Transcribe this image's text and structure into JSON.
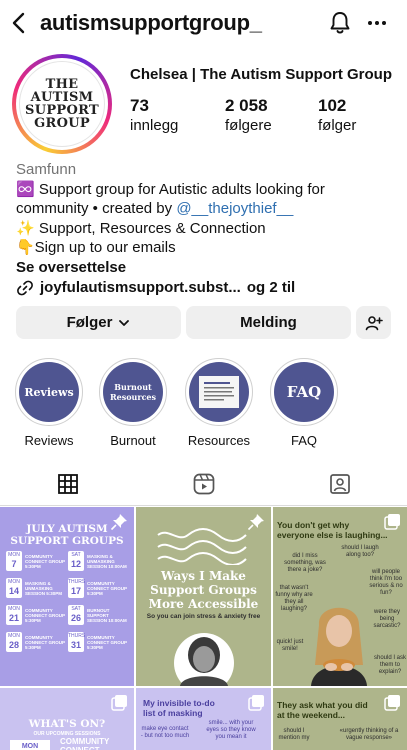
{
  "header": {
    "username": "autismsupportgroup_"
  },
  "profile": {
    "avatar_text": "THE\nAUTISM\nSUPPORT\nGROUP",
    "display_name": "Chelsea | The Autism Support Group",
    "stats": [
      {
        "value": "73",
        "label": "innlegg"
      },
      {
        "value": "2 058",
        "label": "følgere"
      },
      {
        "value": "102",
        "label": "følger"
      }
    ]
  },
  "bio": {
    "category": "Samfunn",
    "line1": "♾️ Support group for Autistic adults looking for",
    "line2_prefix": "community • created by ",
    "mention": "@__thejoythief__",
    "line3": "✨ Support, Resources & Connection",
    "line4": "👇Sign up to our emails",
    "translate": "Se oversettelse",
    "link": "joyfulautismsupport.subst...",
    "link_extra": "og 2 til"
  },
  "actions": {
    "following_label": "Følger",
    "message_label": "Melding"
  },
  "highlights": [
    {
      "label": "Reviews",
      "cover": "Reviews"
    },
    {
      "label": "Burnout",
      "cover": "Burnout\nResources"
    },
    {
      "label": "Resources",
      "cover": ""
    },
    {
      "label": "FAQ",
      "cover": "FAQ"
    }
  ],
  "posts": {
    "p1": {
      "title": "JULY AUTISM\nSUPPORT GROUPS",
      "rows": [
        {
          "d1": "MON",
          "n1": "7",
          "t1": "Community Connect Group 5:30pm",
          "d2": "SAT",
          "n2": "12",
          "t2": "Masking & Unmasking Session 10:00am"
        },
        {
          "d1": "MON",
          "n1": "14",
          "t1": "Masking & Unmasking Session 5:30pm",
          "d2": "THURS",
          "n2": "17",
          "t2": "Community Connect Group 5:30pm"
        },
        {
          "d1": "MON",
          "n1": "21",
          "t1": "Community Connect Group 5:30pm",
          "d2": "SAT",
          "n2": "26",
          "t2": "Burnout Support Session 10:00am"
        },
        {
          "d1": "MON",
          "n1": "28",
          "t1": "Community Connect Group 5:30pm",
          "d2": "THURS",
          "n2": "31",
          "t2": "Community Connect Group 5:30pm"
        }
      ]
    },
    "p2": {
      "title": "Ways I Make\nSupport Groups\nMore Accessible",
      "subtitle": "So you can join stress & anxiety free"
    },
    "p3": {
      "title": "You don't get why\neveryone else is laughing...",
      "bubbles": [
        "did I miss something, was there a joke?",
        "should I laugh along too?",
        "will people think I'm too serious & no fun?",
        "that wasn't funny why are they all laughing?",
        "were they being sarcastic?",
        "quick! just smile!",
        "should I ask them to explain?"
      ]
    },
    "p4": {
      "title": "WHAT'S ON?",
      "subtitle": "OUR UPCOMING SESSIONS",
      "day": "MON",
      "session": "COMMUNITY\nCONNECT"
    },
    "p5": {
      "title": "My invisible to-do\nlist of masking",
      "bubbles": [
        "make eye contact - but not too much",
        "smile... with your eyes so they know you mean it"
      ]
    },
    "p6": {
      "title": "They ask what you did\nat the weekend...",
      "bubbles": [
        "should I mention my",
        "«urgently thinking of a vague response»"
      ]
    }
  }
}
